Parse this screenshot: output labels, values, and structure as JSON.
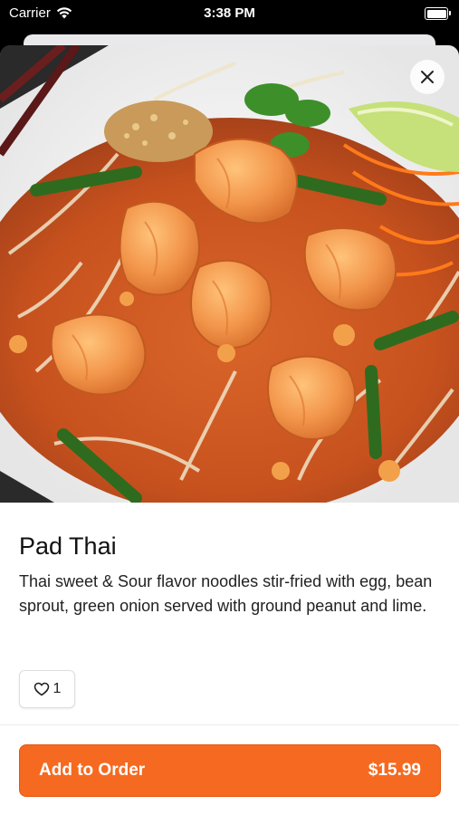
{
  "status_bar": {
    "carrier": "Carrier",
    "time": "3:38 PM"
  },
  "dish": {
    "image_icon": "pad-thai-photo",
    "name": "Pad Thai",
    "description": "Thai sweet & Sour flavor noodles stir-fried with egg, bean sprout, green onion served with ground peanut and lime.",
    "likes": "1"
  },
  "order_button": {
    "label": "Add to Order",
    "price": "$15.99"
  },
  "colors": {
    "accent": "#f56a20",
    "text": "#111111"
  }
}
